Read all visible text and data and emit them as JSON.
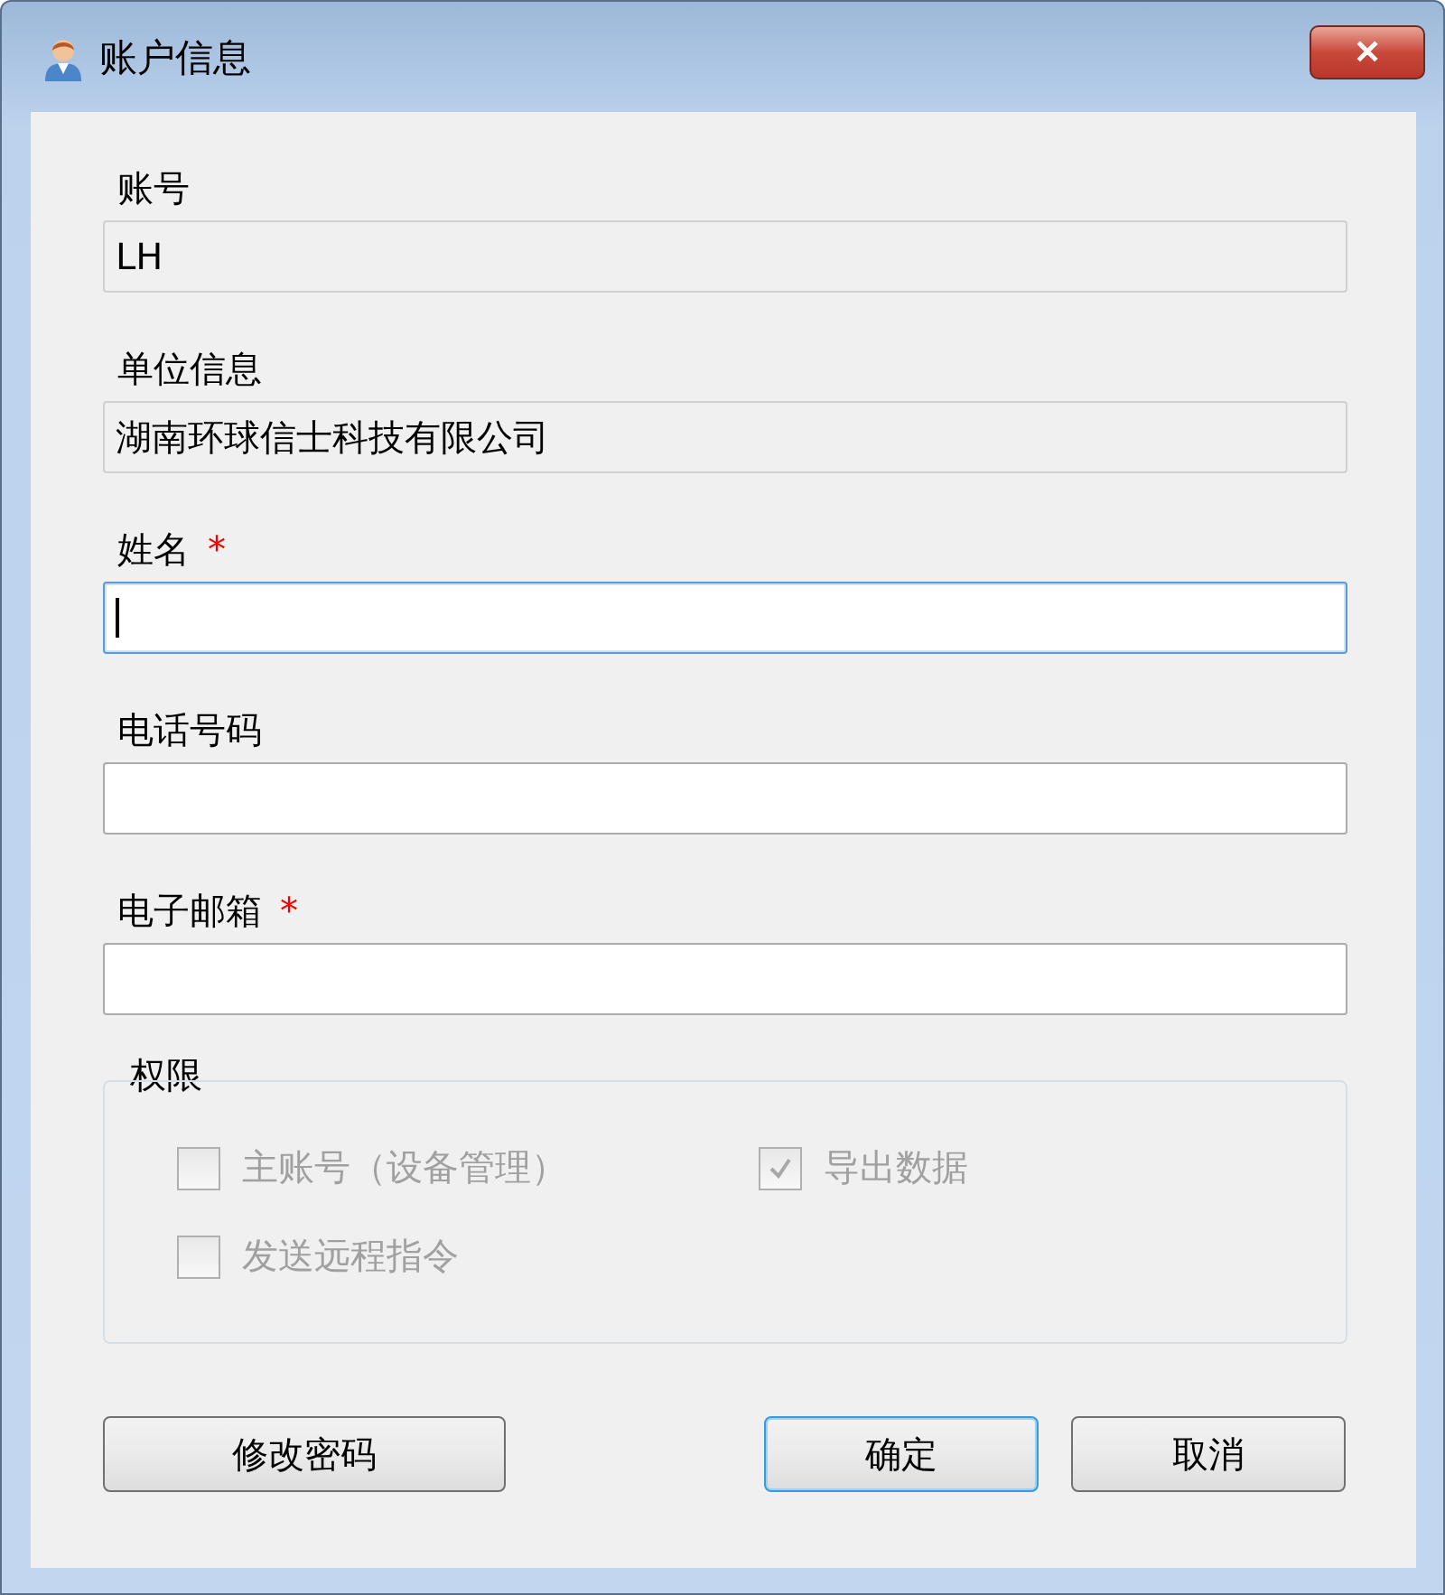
{
  "window": {
    "title": "账户信息",
    "close": "✕"
  },
  "fields": [
    {
      "label": "账号",
      "required": false,
      "readonly": true,
      "focused": false,
      "value": "LH"
    },
    {
      "label": "单位信息",
      "required": false,
      "readonly": true,
      "focused": false,
      "value": "湖南环球信士科技有限公司"
    },
    {
      "label": "姓名",
      "required": true,
      "readonly": false,
      "focused": true
    },
    {
      "label": "电话号码",
      "required": false,
      "readonly": false,
      "focused": false
    },
    {
      "label": "电子邮箱",
      "required": true,
      "readonly": false,
      "focused": false
    }
  ],
  "required_mark": "*",
  "permissions": {
    "title": "权限",
    "items": [
      {
        "label": "主账号（设备管理）",
        "checked": false,
        "disabled": true
      },
      {
        "label": "导出数据",
        "checked": true,
        "disabled": true
      },
      {
        "label": "发送远程指令",
        "checked": false,
        "disabled": true
      }
    ]
  },
  "buttons": [
    {
      "label": "修改密码",
      "default": false
    },
    {
      "label": "确定",
      "default": true
    },
    {
      "label": "取消",
      "default": false
    }
  ]
}
